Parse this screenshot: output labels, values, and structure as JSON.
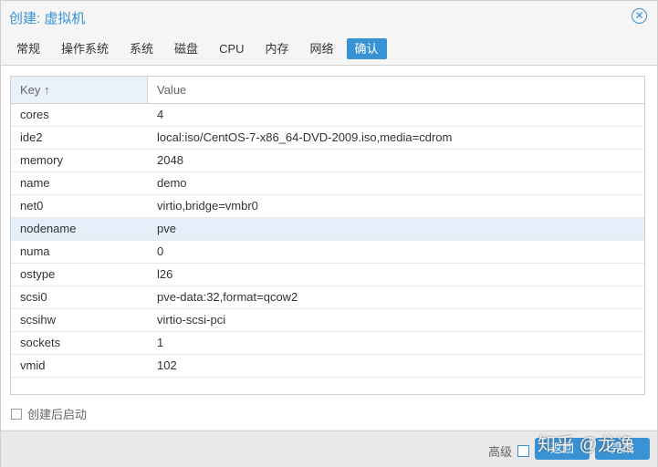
{
  "title": "创建: 虚拟机",
  "tabs": [
    "常规",
    "操作系统",
    "系统",
    "磁盘",
    "CPU",
    "内存",
    "网络",
    "确认"
  ],
  "grid": {
    "headers": {
      "key": "Key ↑",
      "value": "Value"
    },
    "rows": [
      {
        "k": "cores",
        "v": "4"
      },
      {
        "k": "ide2",
        "v": "local:iso/CentOS-7-x86_64-DVD-2009.iso,media=cdrom"
      },
      {
        "k": "memory",
        "v": "2048"
      },
      {
        "k": "name",
        "v": "demo"
      },
      {
        "k": "net0",
        "v": "virtio,bridge=vmbr0"
      },
      {
        "k": "nodename",
        "v": "pve"
      },
      {
        "k": "numa",
        "v": "0"
      },
      {
        "k": "ostype",
        "v": "l26"
      },
      {
        "k": "scsi0",
        "v": "pve-data:32,format=qcow2"
      },
      {
        "k": "scsihw",
        "v": "virtio-scsi-pci"
      },
      {
        "k": "sockets",
        "v": "1"
      },
      {
        "k": "vmid",
        "v": "102"
      }
    ]
  },
  "start_after_create": "创建后启动",
  "footer": {
    "advanced": "高级",
    "back": "返回",
    "finish": "完成"
  },
  "watermark": "知乎 @龙逸"
}
